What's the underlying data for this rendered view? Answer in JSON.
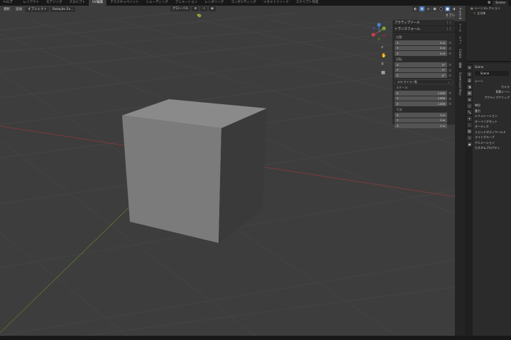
{
  "topbar": {
    "menus": [
      "ヘルプ"
    ],
    "workspaces": [
      "レイアウト",
      "モデリング",
      "スカルプト",
      "UV編集",
      "テクスチャペイント",
      "シェーディング",
      "アニメーション",
      "レンダリング",
      "コンポジティング",
      "ジオメトリノード",
      "スクリプト作成"
    ],
    "active_workspace_index": 3,
    "scene_name": "Scene"
  },
  "viewport_header": {
    "select_label": "選択",
    "add_label": "追加",
    "object_label": "オブジェクト",
    "proportional_label": "Rotação Ex...",
    "transform_orientation": "グローバル",
    "options_label": "オプション"
  },
  "npanel": {
    "active_tool_label": "アクティブツール",
    "transform_label": "トランスフォーム",
    "location_label": "位置:",
    "location": [
      {
        "axis": "X",
        "value": "0 m"
      },
      {
        "axis": "Y",
        "value": "0 m"
      },
      {
        "axis": "Z",
        "value": "0 m"
      }
    ],
    "rotation_label": "回転:",
    "rotation": [
      {
        "axis": "X",
        "value": "0°"
      },
      {
        "axis": "Y",
        "value": "0°"
      },
      {
        "axis": "Z",
        "value": "0°"
      }
    ],
    "rotation_mode": "XYZ オイラー角",
    "scale_label": "スケール:",
    "scale": [
      {
        "axis": "X",
        "value": "1.000"
      },
      {
        "axis": "Y",
        "value": "1.000"
      },
      {
        "axis": "Z",
        "value": "1.000"
      }
    ],
    "dimensions_label": "寸法:",
    "dimensions": [
      {
        "axis": "X",
        "value": "2 m"
      },
      {
        "axis": "Y",
        "value": "2 m"
      },
      {
        "axis": "Z",
        "value": "2 m"
      }
    ]
  },
  "vtabs": [
    "アイテム",
    "ツール",
    "ビュー",
    "Create",
    "編集",
    "Screencast Keys"
  ],
  "outliner": {
    "rows": [
      "シーンコレクション",
      "立方体"
    ]
  },
  "properties": {
    "header": "Scene",
    "scene_field": "Scene",
    "section": "シーン",
    "rows": [
      "カメラ",
      "背景シーン",
      "アクティブクリップ"
    ],
    "panels": [
      "単位",
      "重力",
      "シミュレーション",
      "キーイングセット",
      "オーディオ",
      "リジッドボディワールド",
      "ライトグループ",
      "アニメーション",
      "カスタムプロパティ"
    ]
  },
  "colors": {
    "viewport_bg": "#3d3d3d",
    "grid": "#4a4a4a",
    "x_axis": "#8f3a3a",
    "y_axis": "#5d7a30",
    "cube_top": "#8a8a8a",
    "cube_front": "#7b7b7b",
    "cube_side": "#3a3a3a",
    "accent": "#4772b3"
  }
}
